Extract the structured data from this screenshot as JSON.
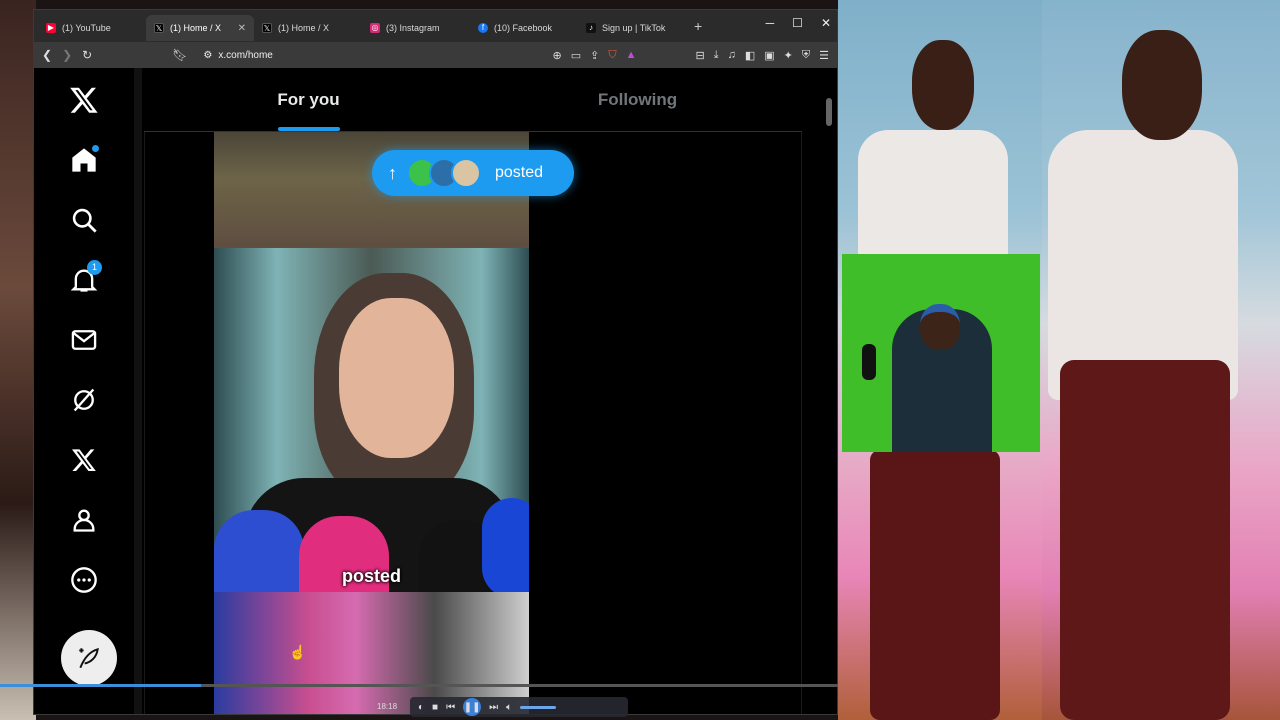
{
  "browser": {
    "tabs": [
      {
        "label": "(1) YouTube",
        "icon": "youtube-icon",
        "color": "#ff0033",
        "active": false
      },
      {
        "label": "(1) Home / X",
        "icon": "x-logo-icon",
        "color": "#000000",
        "active": true
      },
      {
        "label": "(1) Home / X",
        "icon": "x-logo-icon",
        "color": "#000000",
        "active": false
      },
      {
        "label": "(3) Instagram",
        "icon": "instagram-icon",
        "color": "#d62976",
        "active": false
      },
      {
        "label": "(10) Facebook",
        "icon": "facebook-icon",
        "color": "#1877f2",
        "active": false
      },
      {
        "label": "Sign up | TikTok",
        "icon": "tiktok-icon",
        "color": "#111111",
        "active": false
      }
    ],
    "url": "x.com/home"
  },
  "x": {
    "header_tabs": {
      "for_you": "For you",
      "following": "Following"
    },
    "notification_badge": "1",
    "posted_pill": "posted",
    "video_caption": "posted",
    "accent": "#1d9bf0"
  },
  "player": {
    "time": "18:18",
    "progress": 0.24
  }
}
